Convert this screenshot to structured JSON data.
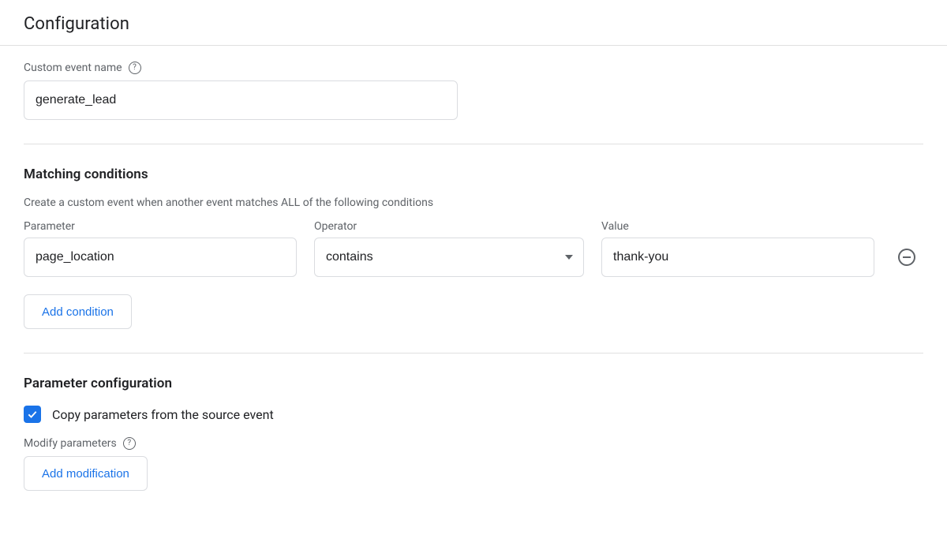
{
  "header": {
    "title": "Configuration"
  },
  "event_name": {
    "label": "Custom event name",
    "value": "generate_lead"
  },
  "matching": {
    "heading": "Matching conditions",
    "description": "Create a custom event when another event matches ALL of the following conditions",
    "columns": {
      "parameter": "Parameter",
      "operator": "Operator",
      "value": "Value"
    },
    "rows": [
      {
        "parameter": "page_location",
        "operator": "contains",
        "value": "thank-you"
      }
    ],
    "add_label": "Add condition"
  },
  "param_config": {
    "heading": "Parameter configuration",
    "copy_label": "Copy parameters from the source event",
    "copy_checked": true,
    "modify_label": "Modify parameters",
    "add_label": "Add modification"
  }
}
